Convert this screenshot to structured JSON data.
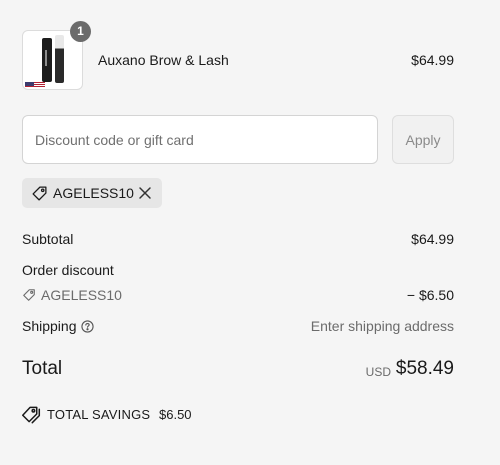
{
  "cart": {
    "item": {
      "name": "Auxano Brow & Lash",
      "price": "$64.99",
      "quantity": "1",
      "image_icon": "product-thumbnail"
    }
  },
  "discount": {
    "placeholder": "Discount code or gift card",
    "value": "",
    "apply_label": "Apply",
    "applied_code": "AGELESS10",
    "icons": {
      "tag": "tag-icon",
      "remove": "close-icon"
    }
  },
  "summary": {
    "subtotal_label": "Subtotal",
    "subtotal_value": "$64.99",
    "order_discount_label": "Order discount",
    "order_discount_code": "AGELESS10",
    "order_discount_value": "− $6.50",
    "shipping_label": "Shipping",
    "shipping_value": "Enter shipping address",
    "total_label": "Total",
    "total_currency": "USD",
    "total_value": "$58.49",
    "savings_label": "TOTAL SAVINGS",
    "savings_value": "$6.50"
  },
  "colors": {
    "background": "#f5f5f5",
    "text": "#1a1a1a",
    "muted_text": "#6b6b6b",
    "badge": "#6b6b6b",
    "chip": "#e6e6e6"
  }
}
